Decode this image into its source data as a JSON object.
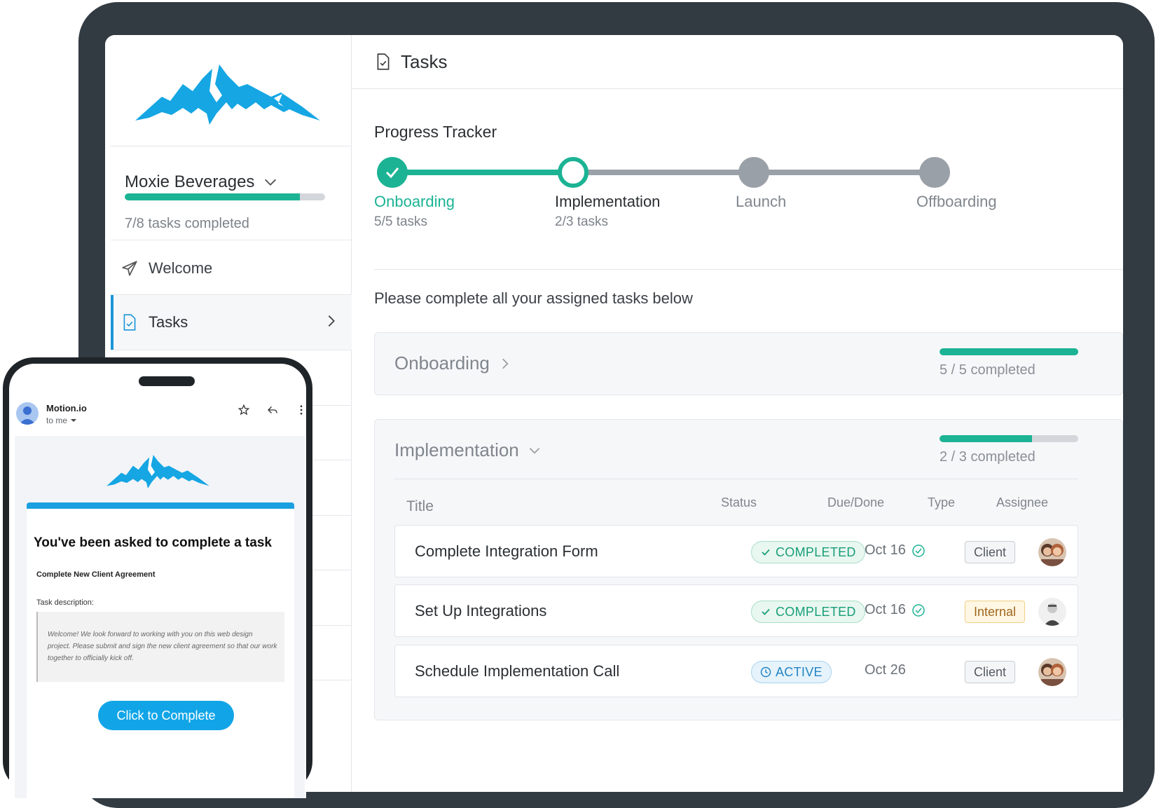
{
  "colors": {
    "accent": "#1bb394",
    "brand_blue": "#1aa0e0",
    "device_frame": "#323a42"
  },
  "sidebar": {
    "client_name": "Moxie Beverages",
    "progress": {
      "fraction": 0.875,
      "text": "7/8 tasks completed"
    },
    "items": [
      {
        "label": "Welcome",
        "icon": "paper-plane-icon"
      },
      {
        "label": "Tasks",
        "icon": "document-check-icon",
        "active": true
      }
    ]
  },
  "header": {
    "title": "Tasks",
    "icon": "document-check-icon"
  },
  "progress_tracker": {
    "title": "Progress Tracker",
    "steps": [
      {
        "label": "Onboarding",
        "sub": "5/5 tasks",
        "state": "done"
      },
      {
        "label": "Implementation",
        "sub": "2/3 tasks",
        "state": "current"
      },
      {
        "label": "Launch",
        "sub": "",
        "state": "upcoming"
      },
      {
        "label": "Offboarding",
        "sub": "",
        "state": "upcoming"
      }
    ]
  },
  "instructions": "Please complete all your assigned tasks below",
  "sections": [
    {
      "title": "Onboarding",
      "completed_text": "5 / 5 completed",
      "fraction": 1.0,
      "expanded": false
    },
    {
      "title": "Implementation",
      "completed_text": "2 / 3 completed",
      "fraction": 0.6667,
      "expanded": true
    }
  ],
  "table": {
    "headers": {
      "title": "Title",
      "status": "Status",
      "due": "Due/Done",
      "type": "Type",
      "assignee": "Assignee"
    },
    "rows": [
      {
        "title": "Complete Integration Form",
        "status": "COMPLETED",
        "due": "Oct 16",
        "done": true,
        "type": "Client"
      },
      {
        "title": "Set Up Integrations",
        "status": "COMPLETED",
        "due": "Oct 16",
        "done": true,
        "type": "Internal"
      },
      {
        "title": "Schedule Implementation Call",
        "status": "ACTIVE",
        "due": "Oct 26",
        "done": false,
        "type": "Client"
      }
    ]
  },
  "email": {
    "sender": "Motion.io",
    "to": "to me",
    "heading": "You've been asked to complete a task",
    "task_name": "Complete New Client Agreement",
    "description_label": "Task description:",
    "description": "Welcome! We look forward to working with you on this web design project. Please submit and sign the new client agreement so that our work together to officially kick off.",
    "button": "Click to Complete"
  }
}
